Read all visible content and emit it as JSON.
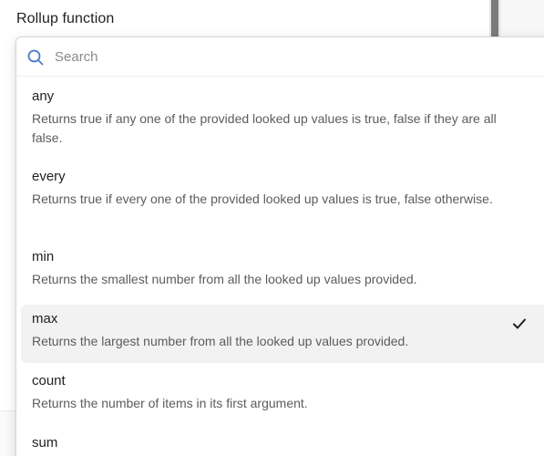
{
  "field": {
    "label": "Rollup function"
  },
  "search": {
    "placeholder": "Search",
    "value": ""
  },
  "options": [
    {
      "name": "any",
      "description": "Returns true if any one of the provided looked up values is true, false if they are all false.",
      "selected": false
    },
    {
      "name": "every",
      "description": "Returns true if every one of the provided looked up values is true, false otherwise.",
      "selected": false
    },
    {
      "name": "min",
      "description": "Returns the smallest number from all the looked up values provided.",
      "selected": false
    },
    {
      "name": "max",
      "description": "Returns the largest number from all the looked up values provided.",
      "selected": true
    },
    {
      "name": "count",
      "description": "Returns the number of items in its first argument.",
      "selected": false
    },
    {
      "name": "sum",
      "description": "",
      "selected": false
    }
  ],
  "icons": {
    "search": "search-icon",
    "selected": "checkmark-icon"
  },
  "colors": {
    "search_icon": "#4a78c8",
    "selected_background": "#f2f2f2",
    "primary_button": "#b7cbf3"
  }
}
